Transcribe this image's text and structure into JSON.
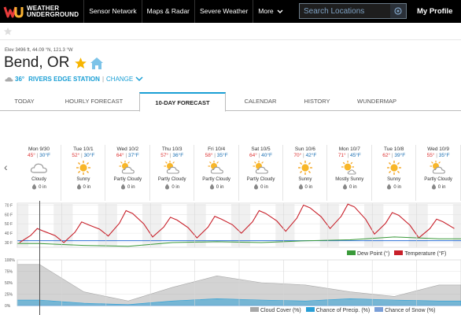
{
  "header": {
    "logo_line1": "WEATHER",
    "logo_line2": "UNDERGROUND",
    "nav": [
      "Sensor Network",
      "Maps & Radar",
      "Severe Weather",
      "More"
    ],
    "search_placeholder": "Search Locations",
    "profile": "My Profile"
  },
  "location": {
    "elevation": "Elev 3496 ft, 44.09 °N, 121.3 °W",
    "city": "Bend, OR",
    "station_temp": "36°",
    "station_name": "RIVERS EDGE STATION",
    "change_label": "CHANGE"
  },
  "tabs": [
    {
      "label": "TODAY",
      "active": false
    },
    {
      "label": "HOURLY FORECAST",
      "active": false
    },
    {
      "label": "10-DAY FORECAST",
      "active": true
    },
    {
      "label": "CALENDAR",
      "active": false
    },
    {
      "label": "HISTORY",
      "active": false
    },
    {
      "label": "WUNDERMAP",
      "active": false
    }
  ],
  "days": [
    {
      "name": "Mon 9/30",
      "hi": "45°",
      "lo": "30°F",
      "icon": "cloudy-icon",
      "desc": "Cloudy",
      "precip": "0 in"
    },
    {
      "name": "Tue 10/1",
      "hi": "52°",
      "lo": "30°F",
      "icon": "sunny-icon",
      "desc": "Sunny",
      "precip": "0 in"
    },
    {
      "name": "Wed 10/2",
      "hi": "64°",
      "lo": "37°F",
      "icon": "partly-cloudy-icon",
      "desc": "Partly Cloudy",
      "precip": "0 in"
    },
    {
      "name": "Thu 10/3",
      "hi": "57°",
      "lo": "36°F",
      "icon": "partly-cloudy-icon",
      "desc": "Partly Cloudy",
      "precip": "0 in"
    },
    {
      "name": "Fri 10/4",
      "hi": "58°",
      "lo": "35°F",
      "icon": "partly-cloudy-icon",
      "desc": "Partly Cloudy",
      "precip": "0 in"
    },
    {
      "name": "Sat 10/5",
      "hi": "64°",
      "lo": "40°F",
      "icon": "partly-cloudy-icon",
      "desc": "Partly Cloudy",
      "precip": "0 in"
    },
    {
      "name": "Sun 10/6",
      "hi": "70°",
      "lo": "42°F",
      "icon": "sunny-icon",
      "desc": "Sunny",
      "precip": "0 in"
    },
    {
      "name": "Mon 10/7",
      "hi": "71°",
      "lo": "45°F",
      "icon": "mostly-sunny-icon",
      "desc": "Mostly Sunny",
      "precip": "0 in"
    },
    {
      "name": "Tue 10/8",
      "hi": "62°",
      "lo": "39°F",
      "icon": "sunny-icon",
      "desc": "Sunny",
      "precip": "0 in"
    },
    {
      "name": "Wed 10/9",
      "hi": "55°",
      "lo": "35°F",
      "icon": "partly-cloudy-icon",
      "desc": "Partly Cloudy",
      "precip": "0 in"
    }
  ],
  "temp_chart": {
    "y_ticks": [
      "70 F",
      "60 F",
      "50 F",
      "40 F",
      "30 F"
    ],
    "legend": [
      "Dew Point (°)",
      "Temperature (°F)"
    ],
    "colors": {
      "temperature": "#c8202a",
      "dew_point": "#3a9a3a",
      "freezing": "#2a6fd6"
    }
  },
  "cloud_chart": {
    "y_ticks": [
      "100%",
      "75%",
      "50%",
      "25%",
      "0%"
    ],
    "legend": [
      "Cloud Cover (%)",
      "Chance of Precip. (%)",
      "Chance of Snow (%)"
    ],
    "colors": {
      "cloud": "#a8a8a8",
      "precip": "#2a9fd6",
      "snow": "#7a9fd8"
    }
  },
  "chart_data": [
    {
      "type": "line",
      "x": [
        "Mon 9/30",
        "Tue 10/1",
        "Wed 10/2",
        "Thu 10/3",
        "Fri 10/4",
        "Sat 10/5",
        "Sun 10/6",
        "Mon 10/7",
        "Tue 10/8",
        "Wed 10/9"
      ],
      "series": [
        {
          "name": "Temperature (°F)",
          "highs": [
            45,
            52,
            64,
            57,
            58,
            64,
            70,
            71,
            62,
            55
          ],
          "lows": [
            30,
            30,
            37,
            36,
            35,
            40,
            42,
            45,
            39,
            35
          ]
        },
        {
          "name": "Dew Point (°)",
          "values": [
            29,
            27,
            26,
            30,
            31,
            30,
            32,
            33,
            36,
            34
          ]
        }
      ],
      "ylim": [
        25,
        72
      ],
      "grid": true,
      "legend_position": "bottom-right"
    },
    {
      "type": "area",
      "x": [
        "Mon 9/30",
        "Tue 10/1",
        "Wed 10/2",
        "Thu 10/3",
        "Fri 10/4",
        "Sat 10/5",
        "Sun 10/6",
        "Mon 10/7",
        "Tue 10/8",
        "Wed 10/9"
      ],
      "series": [
        {
          "name": "Cloud Cover (%)",
          "values": [
            90,
            30,
            10,
            40,
            65,
            50,
            45,
            30,
            20,
            45
          ]
        },
        {
          "name": "Chance of Precip. (%)",
          "values": [
            12,
            5,
            2,
            10,
            15,
            12,
            10,
            15,
            12,
            10
          ]
        },
        {
          "name": "Chance of Snow (%)",
          "values": [
            0,
            0,
            0,
            0,
            0,
            0,
            0,
            0,
            0,
            0
          ]
        }
      ],
      "ylim": [
        0,
        100
      ],
      "legend_position": "bottom-right"
    }
  ]
}
